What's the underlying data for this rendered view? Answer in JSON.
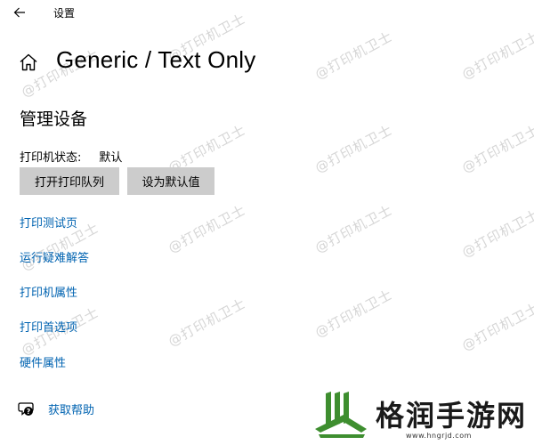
{
  "window": {
    "title": "设置",
    "back_glyph": "←"
  },
  "header": {
    "home_icon": "home-icon",
    "title": "Generic / Text Only"
  },
  "manage": {
    "section_title": "管理设备",
    "status_label": "打印机状态:",
    "status_value": "默认",
    "buttons": [
      {
        "label": "打开打印队列"
      },
      {
        "label": "设为默认值"
      }
    ]
  },
  "links": [
    {
      "label": "打印测试页"
    },
    {
      "label": "运行疑难解答"
    },
    {
      "label": "打印机属性"
    },
    {
      "label": "打印首选项"
    },
    {
      "label": "硬件属性"
    }
  ],
  "help": {
    "icon": "help-chat-icon",
    "label": "获取帮助"
  },
  "watermark": {
    "text": "@打印机卫士"
  },
  "brand": {
    "name": "格润手游网",
    "url": "www.hngrjd.com"
  },
  "colors": {
    "link": "#0063b1",
    "button_bg": "#cccccc",
    "brand_green": "#3e8e2f"
  }
}
